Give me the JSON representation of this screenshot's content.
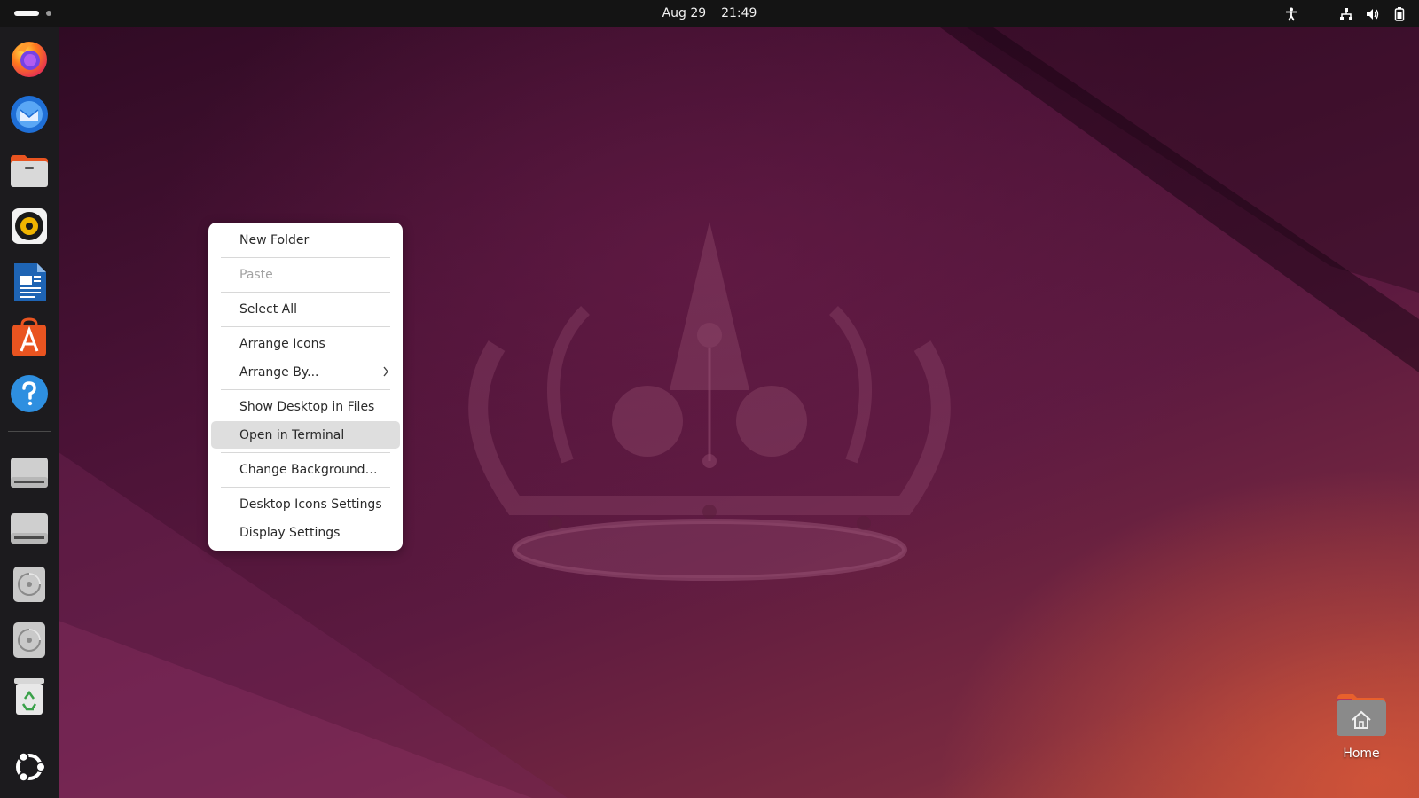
{
  "topbar": {
    "date": "Aug 29",
    "time": "21:49",
    "tray_icons": [
      "accessibility-icon",
      "network-icon",
      "volume-icon",
      "battery-icon"
    ]
  },
  "dock": {
    "items": [
      {
        "name": "firefox-icon"
      },
      {
        "name": "thunderbird-icon"
      },
      {
        "name": "files-icon"
      },
      {
        "name": "rhythmbox-icon"
      },
      {
        "name": "libreoffice-writer-icon"
      },
      {
        "name": "app-center-icon"
      },
      {
        "name": "help-icon"
      },
      {
        "name": "drive-icon"
      },
      {
        "name": "drive-icon"
      },
      {
        "name": "optical-disc-icon"
      },
      {
        "name": "optical-disc-icon"
      },
      {
        "name": "trash-icon"
      }
    ],
    "show_apps": "ubuntu-show-apps-icon"
  },
  "context_menu": {
    "new_folder": "New Folder",
    "paste": "Paste",
    "select_all": "Select All",
    "arrange_icons": "Arrange Icons",
    "arrange_by": "Arrange By...",
    "show_desktop_in_files": "Show Desktop in Files",
    "open_in_terminal": "Open in Terminal",
    "change_background": "Change Background…",
    "desktop_icons_settings": "Desktop Icons Settings",
    "display_settings": "Display Settings"
  },
  "desktop": {
    "home_label": "Home"
  },
  "colors": {
    "topbar": "#141414",
    "dock": "#1c1b1e",
    "menu_hover": "#dedede",
    "menu_disabled_text": "#a3a3a3"
  }
}
